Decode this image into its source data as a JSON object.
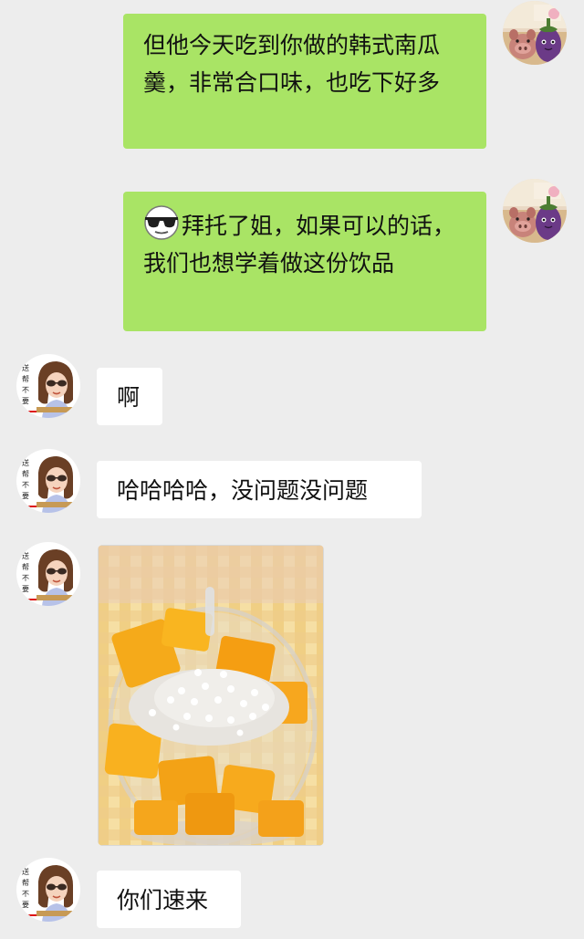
{
  "conversation": {
    "messages": [
      {
        "sender": "self",
        "text": "但他今天吃到你做的韩式南瓜羹，非常合口味，也吃下好多"
      },
      {
        "sender": "self",
        "emoji": "sunglasses-emoji",
        "text": "拜托了姐，如果可以的话，我们也想学着做这份饮品"
      },
      {
        "sender": "other",
        "text": "啊"
      },
      {
        "sender": "other",
        "text": "哈哈哈哈，没问题没问题"
      },
      {
        "sender": "other",
        "image": "mango-sago-photo"
      },
      {
        "sender": "other",
        "text": "你们速来"
      }
    ]
  },
  "avatars": {
    "self": "pig-and-eggplant-plush-avatar",
    "other": "cartoon-girl-sunglasses-avatar"
  },
  "colors": {
    "background": "#ededed",
    "self_bubble": "#a9e465",
    "other_bubble": "#ffffff",
    "text": "#111111"
  }
}
